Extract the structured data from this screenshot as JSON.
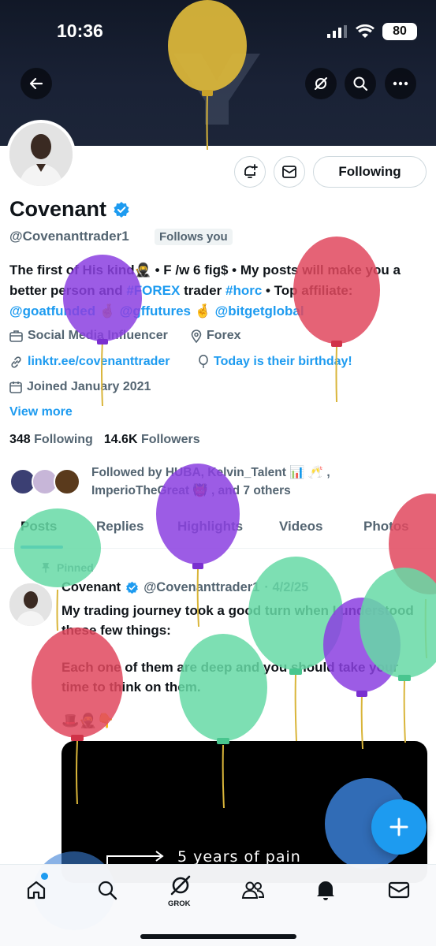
{
  "status_bar": {
    "time": "10:36",
    "battery": "80"
  },
  "profile": {
    "name": "Covenant",
    "handle": "@Covenanttrader1",
    "follows_you": "Follows you",
    "following_button": "Following",
    "bio": {
      "p1": "The first of His kind",
      "p2": " • F /w 6 fig$ • My posts will make you a better person and ",
      "forex": "#FOREX",
      "p3": " trader ",
      "horc": "#horc",
      "p4": " • Top affiliate: ",
      "m1": "@goatfunded",
      "m2": "@gffutures",
      "m3": "@bitgetglobal"
    },
    "category": "Social Media Influencer",
    "location": "Forex",
    "website": "linktr.ee/covenanttrader",
    "birthday": "Today is their birthday!",
    "joined": "Joined January 2021",
    "view_more": "View more",
    "following_count": "348",
    "following_label": "Following",
    "followers_count": "14.6K",
    "followers_label": "Followers",
    "followed_by_line1": "Followed by HUBA, Kelvin_Talent 📊 🥂 ,",
    "followed_by_line2": "ImperioTheGreat 👹 , and 7 others"
  },
  "tabs": [
    "Posts",
    "Replies",
    "Highlights",
    "Videos",
    "Photos"
  ],
  "post": {
    "pinned": "Pinned",
    "author": "Covenant",
    "handle": "@Covenanttrader1",
    "date": "· 4/2/25",
    "text1": "My trading journey took a good turn when I understood these few things:",
    "text2": "Each one of them are deep and you should take your time to think on them.",
    "emoji": "🎩🥷👇",
    "media_text": "5 years of pain"
  },
  "bottom_nav": {
    "grok_label": "GROK"
  },
  "colors": {
    "accent": "#1d9bf0",
    "banner": "#111827",
    "balloon_yellow": "#d9b53a",
    "balloon_purple": "#8b3fe0",
    "balloon_red": "#e0485e",
    "balloon_green": "#66d9a6",
    "balloon_blue": "#3a7fd6"
  },
  "icons": [
    "back-arrow-icon",
    "grok-icon",
    "search-icon",
    "more-icon",
    "bell-plus-icon",
    "mail-icon",
    "verified-badge-icon",
    "briefcase-icon",
    "location-icon",
    "link-icon",
    "balloon-icon",
    "calendar-icon",
    "pin-icon",
    "plus-icon",
    "home-icon",
    "people-icon",
    "notifications-icon",
    "messages-icon"
  ]
}
